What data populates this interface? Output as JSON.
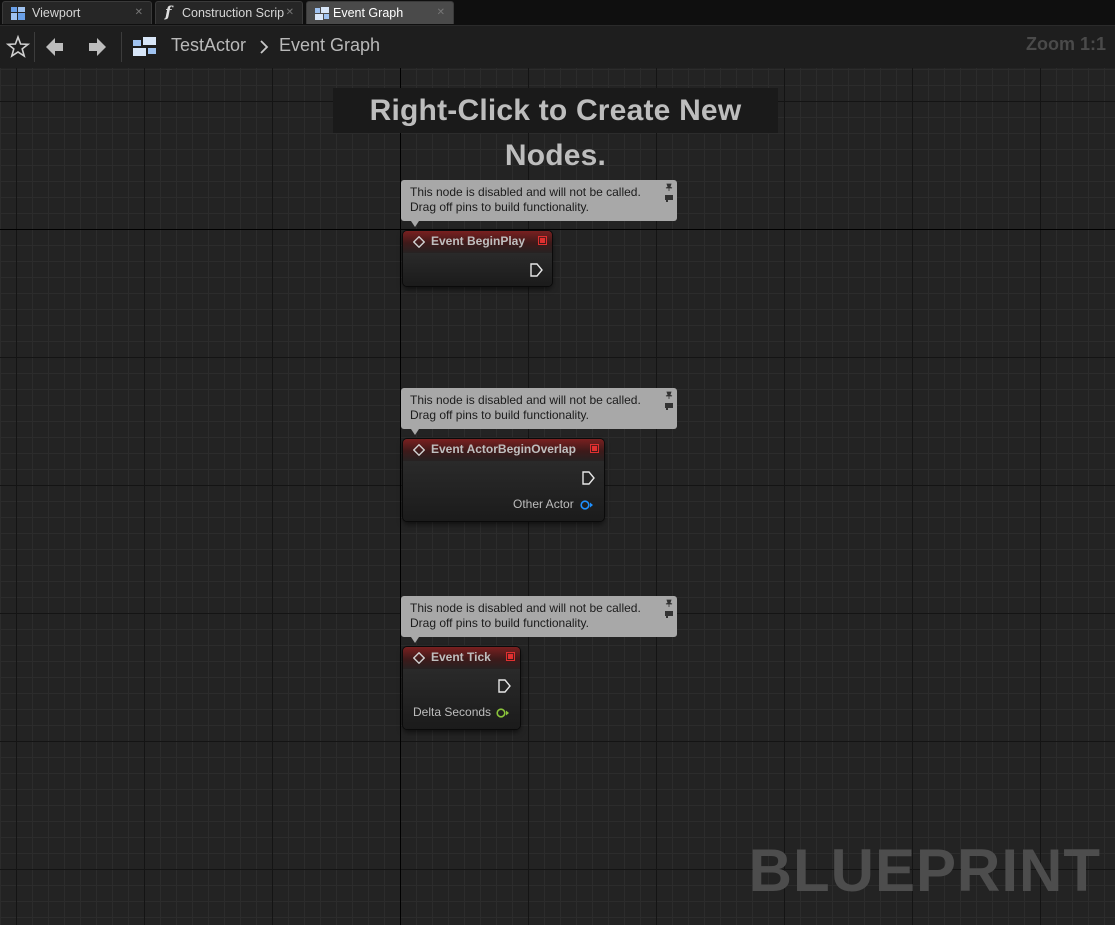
{
  "tabs": [
    {
      "label": "Viewport",
      "icon": "viewport-icon",
      "active": false
    },
    {
      "label": "Construction Scrip",
      "icon": "function-icon",
      "active": false
    },
    {
      "label": "Event Graph",
      "icon": "event-graph-icon",
      "active": true
    }
  ],
  "toolbar": {
    "breadcrumb_root": "TestActor",
    "breadcrumb_current": "Event Graph",
    "zoom": "Zoom 1:1"
  },
  "graph": {
    "hint": "Right-Click to Create New Nodes.",
    "watermark": "BLUEPRINT",
    "comment_line1": "This node is disabled and will not be called.",
    "comment_line2": "Drag off pins to build functionality.",
    "nodes": [
      {
        "title": "Event BeginPlay",
        "pins": []
      },
      {
        "title": "Event ActorBeginOverlap",
        "pins": [
          {
            "label": "Other Actor",
            "color": "#1e90ff"
          }
        ]
      },
      {
        "title": "Event Tick",
        "pins": [
          {
            "label": "Delta Seconds",
            "color": "#8ac43b"
          }
        ]
      }
    ]
  },
  "colors": {
    "event_header": "#7a2020",
    "object_pin": "#1e90ff",
    "float_pin": "#8ac43b",
    "delegate_pin": "#e03030"
  }
}
